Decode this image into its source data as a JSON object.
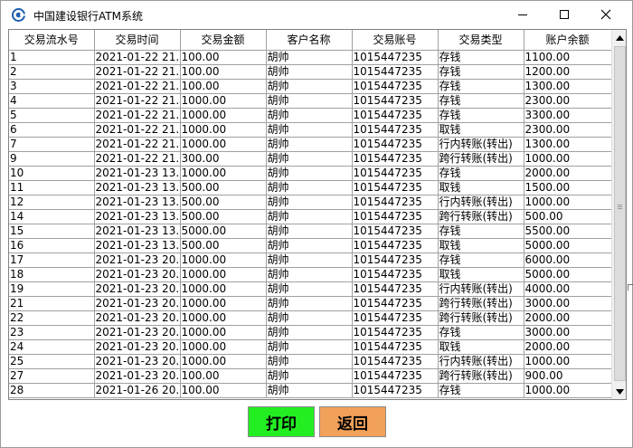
{
  "window": {
    "title": "中国建设银行ATM系统"
  },
  "table": {
    "columns": [
      "交易流水号",
      "交易时间",
      "交易金额",
      "客户名称",
      "交易账号",
      "交易类型",
      "账户余额"
    ],
    "rows": [
      [
        "1",
        "2021-01-22 21...",
        "100.00",
        "胡帅",
        "1015447235",
        "存钱",
        "1100.00"
      ],
      [
        "2",
        "2021-01-22 21...",
        "100.00",
        "胡帅",
        "1015447235",
        "存钱",
        "1200.00"
      ],
      [
        "3",
        "2021-01-22 21...",
        "100.00",
        "胡帅",
        "1015447235",
        "存钱",
        "1300.00"
      ],
      [
        "4",
        "2021-01-22 21...",
        "1000.00",
        "胡帅",
        "1015447235",
        "存钱",
        "2300.00"
      ],
      [
        "5",
        "2021-01-22 21...",
        "1000.00",
        "胡帅",
        "1015447235",
        "存钱",
        "3300.00"
      ],
      [
        "6",
        "2021-01-22 21...",
        "1000.00",
        "胡帅",
        "1015447235",
        "取钱",
        "2300.00"
      ],
      [
        "7",
        "2021-01-22 21...",
        "1000.00",
        "胡帅",
        "1015447235",
        "行内转账(转出)",
        "1300.00"
      ],
      [
        "9",
        "2021-01-22 21...",
        "300.00",
        "胡帅",
        "1015447235",
        "跨行转账(转出)",
        "1000.00"
      ],
      [
        "10",
        "2021-01-23 13...",
        "1000.00",
        "胡帅",
        "1015447235",
        "存钱",
        "2000.00"
      ],
      [
        "11",
        "2021-01-23 13...",
        "500.00",
        "胡帅",
        "1015447235",
        "取钱",
        "1500.00"
      ],
      [
        "12",
        "2021-01-23 13...",
        "500.00",
        "胡帅",
        "1015447235",
        "行内转账(转出)",
        "1000.00"
      ],
      [
        "14",
        "2021-01-23 13...",
        "500.00",
        "胡帅",
        "1015447235",
        "跨行转账(转出)",
        "500.00"
      ],
      [
        "15",
        "2021-01-23 13...",
        "5000.00",
        "胡帅",
        "1015447235",
        "存钱",
        "5500.00"
      ],
      [
        "16",
        "2021-01-23 13...",
        "500.00",
        "胡帅",
        "1015447235",
        "取钱",
        "5000.00"
      ],
      [
        "17",
        "2021-01-23 20...",
        "1000.00",
        "胡帅",
        "1015447235",
        "存钱",
        "6000.00"
      ],
      [
        "18",
        "2021-01-23 20...",
        "1000.00",
        "胡帅",
        "1015447235",
        "取钱",
        "5000.00"
      ],
      [
        "19",
        "2021-01-23 20...",
        "1000.00",
        "胡帅",
        "1015447235",
        "行内转账(转出)",
        "4000.00"
      ],
      [
        "21",
        "2021-01-23 20...",
        "1000.00",
        "胡帅",
        "1015447235",
        "跨行转账(转出)",
        "3000.00"
      ],
      [
        "22",
        "2021-01-23 20...",
        "1000.00",
        "胡帅",
        "1015447235",
        "跨行转账(转出)",
        "2000.00"
      ],
      [
        "23",
        "2021-01-23 20...",
        "1000.00",
        "胡帅",
        "1015447235",
        "存钱",
        "3000.00"
      ],
      [
        "24",
        "2021-01-23 20...",
        "1000.00",
        "胡帅",
        "1015447235",
        "取钱",
        "2000.00"
      ],
      [
        "25",
        "2021-01-23 20...",
        "1000.00",
        "胡帅",
        "1015447235",
        "行内转账(转出)",
        "1000.00"
      ],
      [
        "27",
        "2021-01-23 20...",
        "100.00",
        "胡帅",
        "1015447235",
        "跨行转账(转出)",
        "900.00"
      ],
      [
        "28",
        "2021-01-26 20...",
        "100.00",
        "胡帅",
        "1015447235",
        "存钱",
        "1000.00"
      ]
    ]
  },
  "buttons": {
    "print": "打印",
    "back": "返回"
  },
  "side_fragment": "ㄇ"
}
